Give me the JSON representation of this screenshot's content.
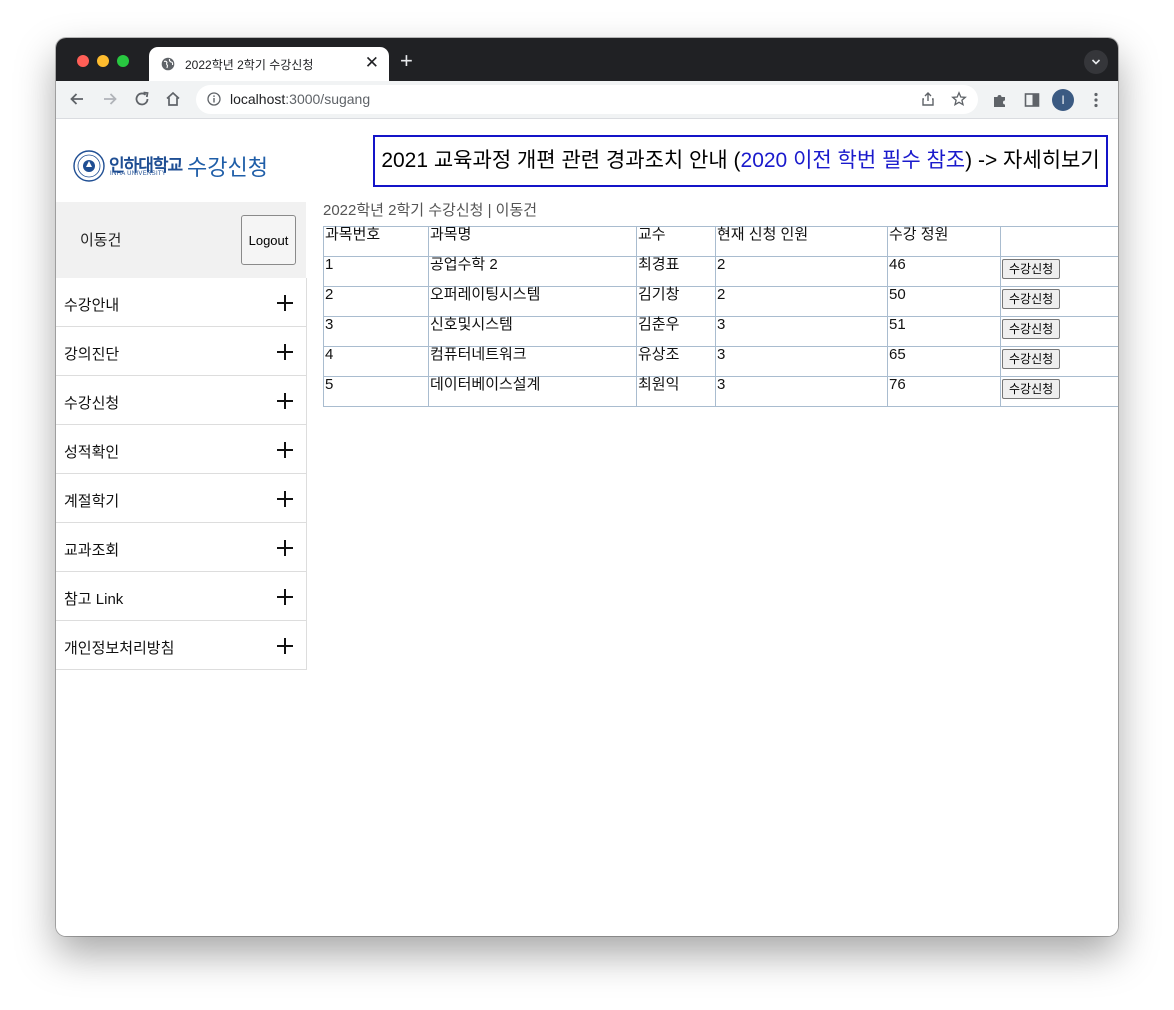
{
  "browser": {
    "tab_title": "2022학년 2학기 수강신청",
    "tab_close": "✕",
    "new_tab": "+",
    "url_host": "localhost",
    "url_path": ":3000/sugang",
    "profile_initial": "I"
  },
  "header": {
    "logo_korean": "인하대학교",
    "logo_english": "INHA UNIVERSITY",
    "site_title": "수강신청",
    "notice_prefix": "2021 교육과정 개편 관련 경과조치 안내 (",
    "notice_highlight": "2020 이전 학번 필수 참조",
    "notice_suffix": ") -> 자세히보기"
  },
  "user": {
    "name": "이동건",
    "logout_label": "Logout"
  },
  "sidebar": {
    "items": [
      {
        "label": "수강안내"
      },
      {
        "label": "강의진단"
      },
      {
        "label": "수강신청"
      },
      {
        "label": "성적확인"
      },
      {
        "label": "계절학기"
      },
      {
        "label": "교과조회"
      },
      {
        "label": "참고 Link"
      },
      {
        "label": "개인정보처리방침"
      }
    ]
  },
  "main": {
    "heading": "2022학년 2학기 수강신청 | 이동건",
    "table": {
      "headers": [
        "과목번호",
        "과목명",
        "교수",
        "현재 신청 인원",
        "수강 정원",
        ""
      ],
      "apply_label": "수강신청",
      "rows": [
        {
          "id": "1",
          "name": "공업수학 2",
          "professor": "최경표",
          "current": "2",
          "capacity": "46"
        },
        {
          "id": "2",
          "name": "오퍼레이팅시스템",
          "professor": "김기창",
          "current": "2",
          "capacity": "50"
        },
        {
          "id": "3",
          "name": "신호및시스템",
          "professor": "김춘우",
          "current": "3",
          "capacity": "51"
        },
        {
          "id": "4",
          "name": "컴퓨터네트워크",
          "professor": "유상조",
          "current": "3",
          "capacity": "65"
        },
        {
          "id": "5",
          "name": "데이터베이스설계",
          "professor": "최원익",
          "current": "3",
          "capacity": "76"
        }
      ]
    }
  },
  "colors": {
    "brand_blue": "#1f5ea8",
    "notice_border": "#1414c8",
    "notice_highlight": "#1a1acc"
  }
}
